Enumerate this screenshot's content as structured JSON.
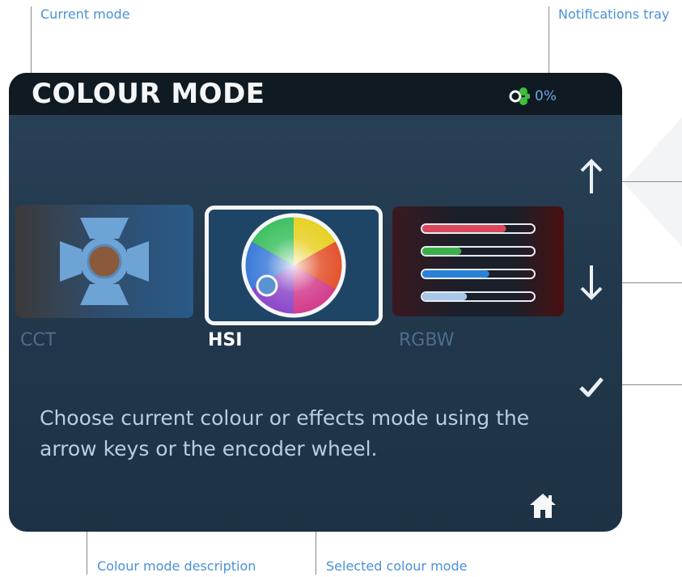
{
  "callouts": {
    "current_mode": "Current mode",
    "notifications_tray": "Notifications tray",
    "colour_mode_description": "Colour mode description",
    "selected_colour_mode": "Selected colour mode"
  },
  "screen": {
    "title": "COLOUR MODE",
    "notification_percent": "0%",
    "modes": [
      {
        "label": "CCT",
        "selected": false
      },
      {
        "label": "HSI",
        "selected": true
      },
      {
        "label": "RGBW",
        "selected": false
      }
    ],
    "description": "Choose current colour or effects mode using the arrow keys or the encoder wheel.",
    "rgbw_levels": [
      0.75,
      0.35,
      0.6,
      0.4
    ]
  },
  "icons": {
    "up": "arrow-up-icon",
    "down": "arrow-down-icon",
    "confirm": "checkmark-icon",
    "home": "home-icon",
    "notifications": "notifications-icon",
    "cct": "fresnel-light-icon",
    "hsi": "colour-wheel-icon",
    "rgbw": "rgbw-sliders-icon"
  },
  "colors": {
    "callout_text": "#4a90d9",
    "selected_border": "#f5f7fa",
    "notification_green": "#3fbf3f"
  }
}
